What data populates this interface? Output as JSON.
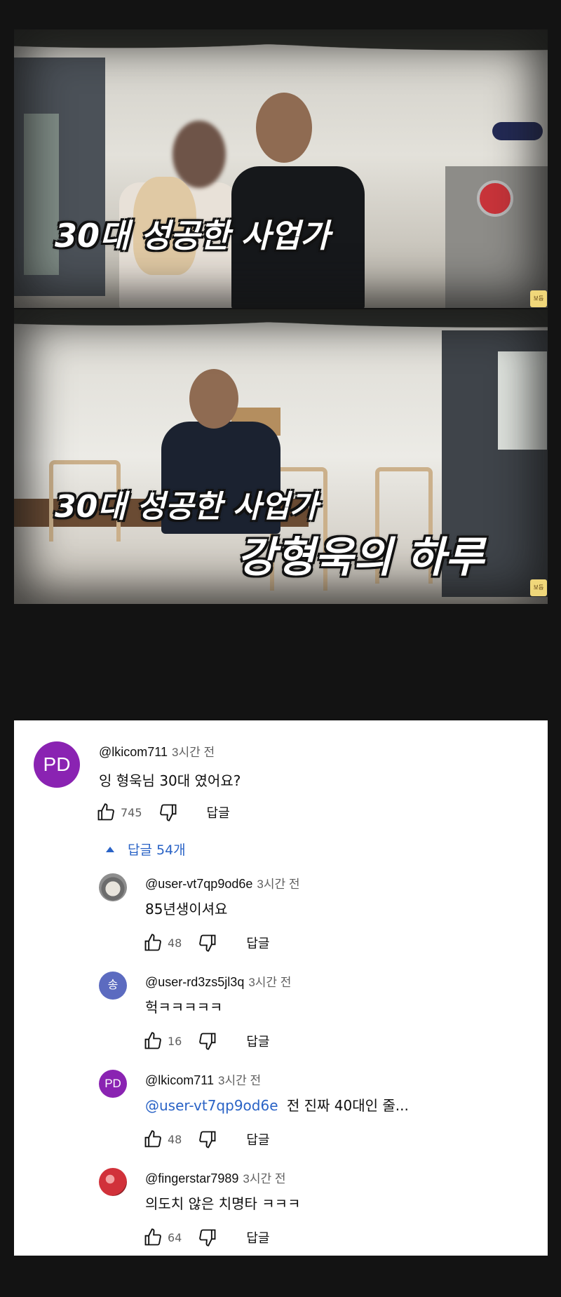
{
  "video": {
    "frame1": {
      "subtitle": "30대 성공한 사업가",
      "badge": "보듬"
    },
    "frame2": {
      "subtitle_line1": "30대 성공한 사업가",
      "subtitle_line2": "강형욱의 하루",
      "badge": "보듬"
    }
  },
  "comments": {
    "main": {
      "avatar_initials": "PD",
      "avatar_color": "#8a23b2",
      "handle": "@lkicom711",
      "time": "3시간 전",
      "text": "잉 형욱님 30대 였어요?",
      "likes": "745",
      "reply_label": "답글"
    },
    "replies_toggle": {
      "icon": "triangle-up-icon",
      "label": "답글 54개"
    },
    "replies": [
      {
        "avatar": "dog-photo",
        "handle": "@user-vt7qp9od6e",
        "time": "3시간 전",
        "text": "85년생이셔요",
        "likes": "48",
        "reply_label": "답글"
      },
      {
        "avatar_initials": "송",
        "avatar_color": "#5c6bc0",
        "handle": "@user-rd3zs5jl3q",
        "time": "3시간 전",
        "text": "헉ㅋㅋㅋㅋㅋ",
        "likes": "16",
        "reply_label": "답글"
      },
      {
        "avatar_initials": "PD",
        "avatar_color": "#8a23b2",
        "handle": "@lkicom711",
        "time": "3시간 전",
        "mention": "@user-vt7qp9od6e",
        "text": "전 진짜 40대인 줄...",
        "likes": "48",
        "reply_label": "답글"
      },
      {
        "avatar": "red-ball-photo",
        "handle": "@fingerstar7989",
        "time": "3시간 전",
        "text": "의도치 않은 치명타 ㅋㅋㅋ",
        "likes": "64",
        "reply_label": "답글"
      }
    ]
  }
}
